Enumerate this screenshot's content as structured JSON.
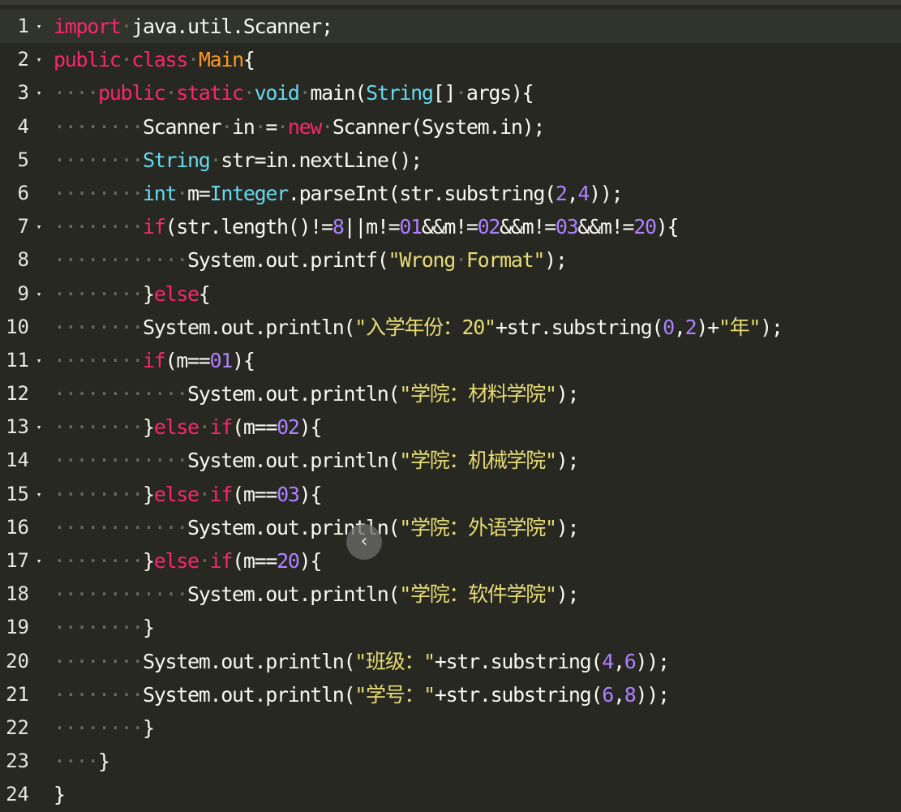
{
  "editor": {
    "active_line": 1,
    "colors": {
      "background": "#272822",
      "keyword": "#f92672",
      "type": "#66d9ef",
      "number": "#ae81ff",
      "string": "#e6db74",
      "class_name": "#fd971f",
      "plain": "#f8f8f2"
    },
    "lines": [
      {
        "num": "1",
        "fold": true,
        "tokens": [
          [
            "k",
            "import"
          ],
          [
            "i",
            "·"
          ],
          [
            "p",
            "java.util.Scanner;"
          ]
        ]
      },
      {
        "num": "2",
        "fold": true,
        "tokens": [
          [
            "k",
            "public"
          ],
          [
            "i",
            "·"
          ],
          [
            "k",
            "class"
          ],
          [
            "i",
            "·"
          ],
          [
            "c",
            "Main"
          ],
          [
            "p",
            "{"
          ]
        ]
      },
      {
        "num": "3",
        "fold": true,
        "tokens": [
          [
            "i",
            "····"
          ],
          [
            "k",
            "public"
          ],
          [
            "i",
            "·"
          ],
          [
            "k",
            "static"
          ],
          [
            "i",
            "·"
          ],
          [
            "t",
            "void"
          ],
          [
            "i",
            "·"
          ],
          [
            "p",
            "main("
          ],
          [
            "t",
            "String"
          ],
          [
            "p",
            "[]"
          ],
          [
            "i",
            "·"
          ],
          [
            "p",
            "args){"
          ]
        ]
      },
      {
        "num": "4",
        "fold": false,
        "tokens": [
          [
            "i",
            "········"
          ],
          [
            "p",
            "Scanner"
          ],
          [
            "i",
            "·"
          ],
          [
            "p",
            "in"
          ],
          [
            "i",
            "·"
          ],
          [
            "p",
            "="
          ],
          [
            "i",
            "·"
          ],
          [
            "k",
            "new"
          ],
          [
            "i",
            "·"
          ],
          [
            "p",
            "Scanner(System.in);"
          ]
        ]
      },
      {
        "num": "5",
        "fold": false,
        "tokens": [
          [
            "i",
            "········"
          ],
          [
            "t",
            "String"
          ],
          [
            "i",
            "·"
          ],
          [
            "p",
            "str=in.nextLine();"
          ]
        ]
      },
      {
        "num": "6",
        "fold": false,
        "tokens": [
          [
            "i",
            "········"
          ],
          [
            "t",
            "int"
          ],
          [
            "i",
            "·"
          ],
          [
            "p",
            "m="
          ],
          [
            "t",
            "Integer"
          ],
          [
            "p",
            ".parseInt(str.substring("
          ],
          [
            "n",
            "2"
          ],
          [
            "p",
            ","
          ],
          [
            "n",
            "4"
          ],
          [
            "p",
            "));"
          ]
        ]
      },
      {
        "num": "7",
        "fold": true,
        "tokens": [
          [
            "i",
            "········"
          ],
          [
            "k",
            "if"
          ],
          [
            "p",
            "(str.length()!="
          ],
          [
            "n",
            "8"
          ],
          [
            "p",
            "||m!="
          ],
          [
            "n",
            "01"
          ],
          [
            "p",
            "&&m!="
          ],
          [
            "n",
            "02"
          ],
          [
            "p",
            "&&m!="
          ],
          [
            "n",
            "03"
          ],
          [
            "p",
            "&&m!="
          ],
          [
            "n",
            "20"
          ],
          [
            "p",
            "){"
          ]
        ]
      },
      {
        "num": "8",
        "fold": false,
        "tokens": [
          [
            "i",
            "············"
          ],
          [
            "p",
            "System.out.printf("
          ],
          [
            "s",
            "\"Wrong"
          ],
          [
            "i",
            "·"
          ],
          [
            "s",
            "Format\""
          ],
          [
            "p",
            ");"
          ]
        ]
      },
      {
        "num": "9",
        "fold": true,
        "tokens": [
          [
            "i",
            "········"
          ],
          [
            "p",
            "}"
          ],
          [
            "k",
            "else"
          ],
          [
            "p",
            "{"
          ]
        ]
      },
      {
        "num": "10",
        "fold": false,
        "tokens": [
          [
            "i",
            "········"
          ],
          [
            "p",
            "System.out.println("
          ],
          [
            "s",
            "\"入学年份：20\""
          ],
          [
            "p",
            "+str.substring("
          ],
          [
            "n",
            "0"
          ],
          [
            "p",
            ","
          ],
          [
            "n",
            "2"
          ],
          [
            "p",
            ")+"
          ],
          [
            "s",
            "\"年\""
          ],
          [
            "p",
            ");"
          ]
        ]
      },
      {
        "num": "11",
        "fold": true,
        "tokens": [
          [
            "i",
            "········"
          ],
          [
            "k",
            "if"
          ],
          [
            "p",
            "(m=="
          ],
          [
            "n",
            "01"
          ],
          [
            "p",
            "){"
          ]
        ]
      },
      {
        "num": "12",
        "fold": false,
        "tokens": [
          [
            "i",
            "············"
          ],
          [
            "p",
            "System.out.println("
          ],
          [
            "s",
            "\"学院：材料学院\""
          ],
          [
            "p",
            ");"
          ]
        ]
      },
      {
        "num": "13",
        "fold": true,
        "tokens": [
          [
            "i",
            "········"
          ],
          [
            "p",
            "}"
          ],
          [
            "k",
            "else"
          ],
          [
            "i",
            "·"
          ],
          [
            "k",
            "if"
          ],
          [
            "p",
            "(m=="
          ],
          [
            "n",
            "02"
          ],
          [
            "p",
            "){"
          ]
        ]
      },
      {
        "num": "14",
        "fold": false,
        "tokens": [
          [
            "i",
            "············"
          ],
          [
            "p",
            "System.out.println("
          ],
          [
            "s",
            "\"学院：机械学院\""
          ],
          [
            "p",
            ");"
          ]
        ]
      },
      {
        "num": "15",
        "fold": true,
        "tokens": [
          [
            "i",
            "········"
          ],
          [
            "p",
            "}"
          ],
          [
            "k",
            "else"
          ],
          [
            "i",
            "·"
          ],
          [
            "k",
            "if"
          ],
          [
            "p",
            "(m=="
          ],
          [
            "n",
            "03"
          ],
          [
            "p",
            "){"
          ]
        ]
      },
      {
        "num": "16",
        "fold": false,
        "tokens": [
          [
            "i",
            "············"
          ],
          [
            "p",
            "System.out.println("
          ],
          [
            "s",
            "\"学院：外语学院\""
          ],
          [
            "p",
            ");"
          ]
        ]
      },
      {
        "num": "17",
        "fold": true,
        "tokens": [
          [
            "i",
            "········"
          ],
          [
            "p",
            "}"
          ],
          [
            "k",
            "else"
          ],
          [
            "i",
            "·"
          ],
          [
            "k",
            "if"
          ],
          [
            "p",
            "(m=="
          ],
          [
            "n",
            "20"
          ],
          [
            "p",
            "){"
          ]
        ]
      },
      {
        "num": "18",
        "fold": false,
        "tokens": [
          [
            "i",
            "············"
          ],
          [
            "p",
            "System.out.println("
          ],
          [
            "s",
            "\"学院：软件学院\""
          ],
          [
            "p",
            ");"
          ]
        ]
      },
      {
        "num": "19",
        "fold": false,
        "tokens": [
          [
            "i",
            "········"
          ],
          [
            "p",
            "}"
          ]
        ]
      },
      {
        "num": "20",
        "fold": false,
        "tokens": [
          [
            "i",
            "········"
          ],
          [
            "p",
            "System.out.println("
          ],
          [
            "s",
            "\"班级：\""
          ],
          [
            "p",
            "+str.substring("
          ],
          [
            "n",
            "4"
          ],
          [
            "p",
            ","
          ],
          [
            "n",
            "6"
          ],
          [
            "p",
            "));"
          ]
        ]
      },
      {
        "num": "21",
        "fold": false,
        "tokens": [
          [
            "i",
            "········"
          ],
          [
            "p",
            "System.out.println("
          ],
          [
            "s",
            "\"学号：\""
          ],
          [
            "p",
            "+str.substring("
          ],
          [
            "n",
            "6"
          ],
          [
            "p",
            ","
          ],
          [
            "n",
            "8"
          ],
          [
            "p",
            "));"
          ]
        ]
      },
      {
        "num": "22",
        "fold": false,
        "tokens": [
          [
            "i",
            "········"
          ],
          [
            "p",
            "}"
          ]
        ]
      },
      {
        "num": "23",
        "fold": false,
        "tokens": [
          [
            "i",
            "····"
          ],
          [
            "p",
            "}"
          ]
        ]
      },
      {
        "num": "24",
        "fold": false,
        "tokens": [
          [
            "p",
            "}"
          ]
        ]
      }
    ]
  },
  "icons": {
    "fold": "▾",
    "scroll_button": "‹"
  }
}
